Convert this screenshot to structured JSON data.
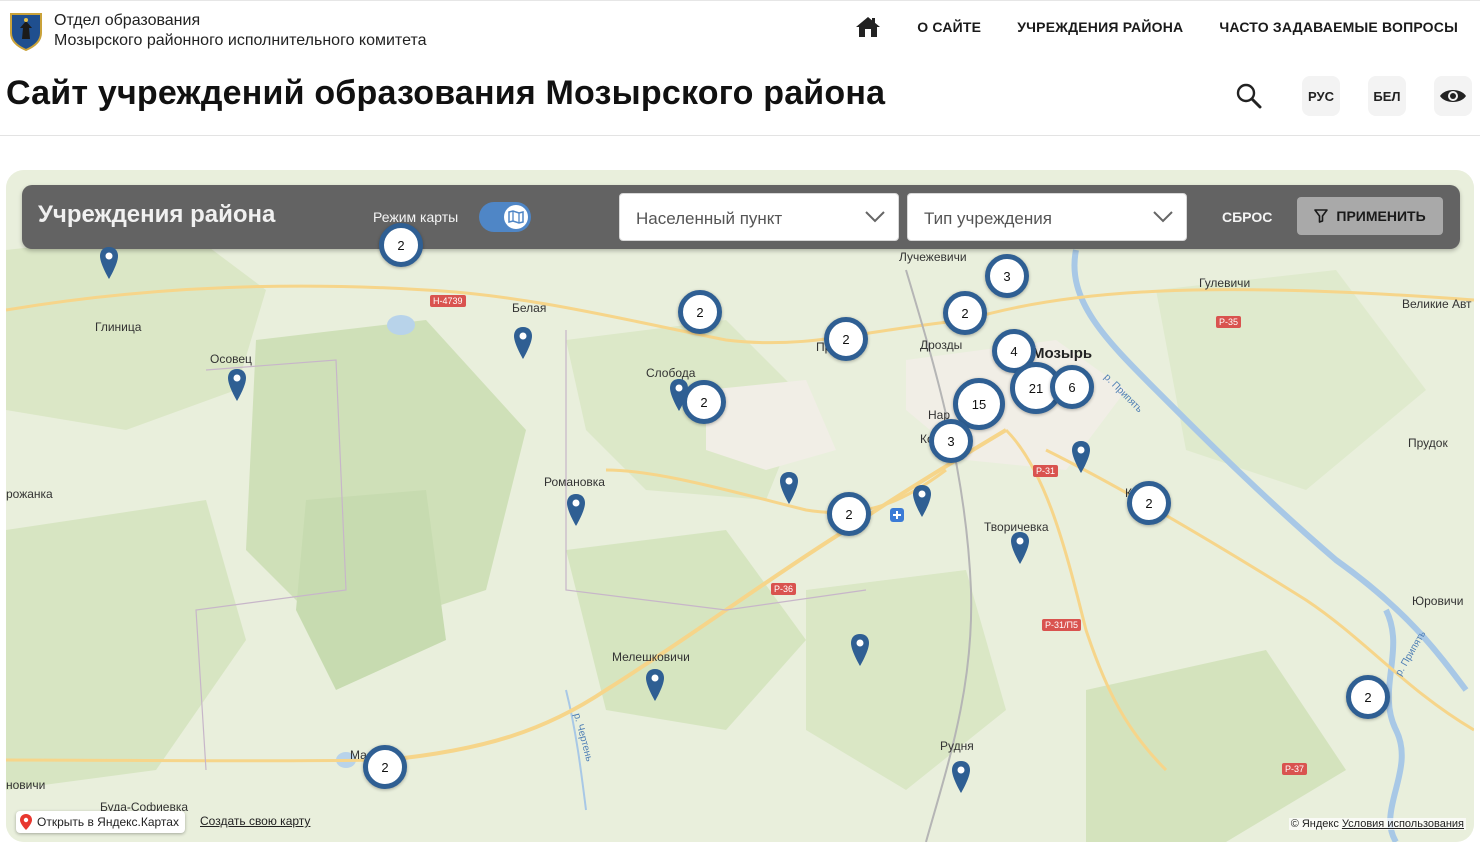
{
  "header": {
    "org_line1": "Отдел образования",
    "org_line2": "Мозырского районного исполнительного комитета",
    "nav": {
      "home_icon": "home-icon",
      "about": "О САЙТЕ",
      "institutions": "УЧРЕЖДЕНИЯ РАЙОНА",
      "faq": "ЧАСТО ЗАДАВАЕМЫЕ ВОПРОСЫ"
    },
    "title": "Сайт учреждений образования Мозырского района",
    "tools": {
      "search_icon": "search-icon",
      "lang_ru": "РУС",
      "lang_be": "БЕЛ",
      "accessibility_icon": "eye-icon"
    }
  },
  "filter": {
    "title": "Учреждения района",
    "mode_label": "Режим карты",
    "map_mode_enabled": true,
    "locality_placeholder": "Населенный пункт",
    "type_placeholder": "Тип учреждения",
    "reset_label": "СБРОС",
    "apply_label": "ПРИМЕНИТЬ"
  },
  "map": {
    "places": {
      "glinitsa": "Глиница",
      "osovets": "Осовец",
      "belaya": "Белая",
      "sloboda": "Слобода",
      "luchezhevichi": "Лучежевичи",
      "gulevichi": "Гулевичи",
      "velikie": "Великие Авт",
      "drozdy": "Дрозды",
      "mozyr": "Мозырь",
      "pr": "Пр",
      "nar": "Нар",
      "ko": "Ко",
      "romanovka": "Романовка",
      "rozhanka": "рожанка",
      "tvorichevka": "Творичевка",
      "kamenny": "Ка     ный",
      "prudok": "Прудок",
      "melishkovichi": "Мелешковичи",
      "yurovichi": "Юровичи",
      "rudnya": "Рудня",
      "ma": "Ма        ни",
      "novichi": "новичи",
      "bulasofievka": "Буда-Софиевка",
      "r_pripyat_1": "р. Припять",
      "r_pripyat_2": "р. Припять",
      "r_chertyen": "р. Чертень"
    },
    "roads": {
      "n4739": "Н-4739",
      "r35": "Р-35",
      "r31": "Р-31",
      "r36": "Р-36",
      "r31p5": "Р-31/П5",
      "r37": "Р-37"
    },
    "clusters": [
      "2",
      "3",
      "2",
      "2",
      "2",
      "4",
      "21",
      "6",
      "2",
      "15",
      "3",
      "2",
      "2",
      "2",
      "2"
    ],
    "open_in_yandex": "Открыть в Яндекс.Картах",
    "create_map": "Создать свою карту",
    "copyright": "© Яндекс",
    "terms": "Условия использования"
  }
}
